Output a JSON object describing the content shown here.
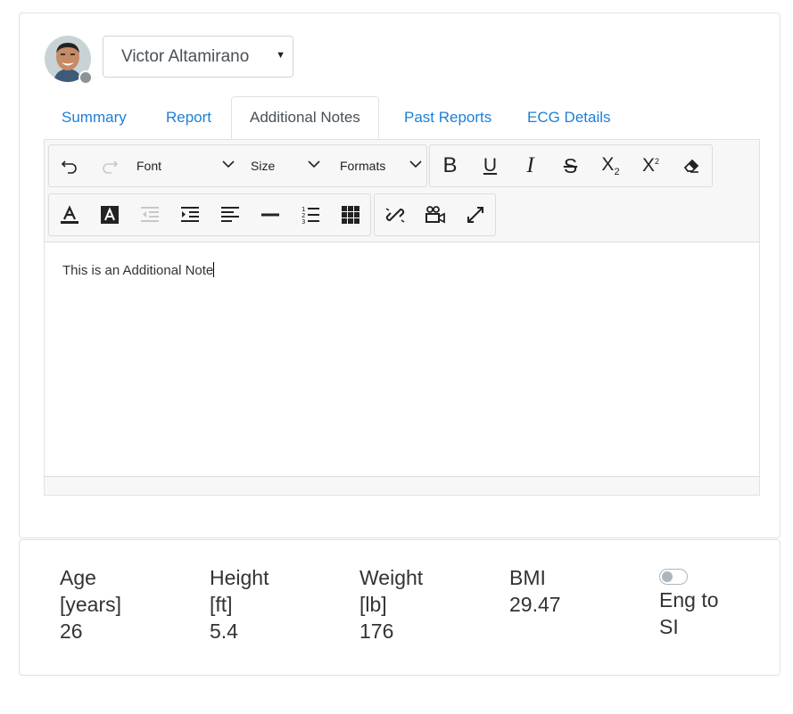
{
  "patient": {
    "name": "Victor Altamirano",
    "status": "offline"
  },
  "tabs": [
    {
      "label": "Summary",
      "active": false
    },
    {
      "label": "Report",
      "active": false
    },
    {
      "label": "Additional Notes",
      "active": true
    },
    {
      "label": "Past Reports",
      "active": false
    },
    {
      "label": "ECG Details",
      "active": false
    }
  ],
  "toolbar": {
    "font_label": "Font",
    "size_label": "Size",
    "formats_label": "Formats"
  },
  "editor": {
    "content": "This is an Additional Note"
  },
  "stats": {
    "age": {
      "label": "Age",
      "unit": "[years]",
      "value": "26"
    },
    "height": {
      "label": "Height",
      "unit": "[ft]",
      "value": "5.4"
    },
    "weight": {
      "label": "Weight",
      "unit": "[lb]",
      "value": "176"
    },
    "bmi": {
      "label": "BMI",
      "value": "29.47"
    },
    "units_toggle": {
      "label_line1": "Eng to",
      "label_line2": "SI",
      "checked": false
    }
  },
  "colors": {
    "link": "#1d7fd6",
    "text": "#333333",
    "border": "#dee2e6",
    "toolbar_bg": "#f7f7f7"
  }
}
